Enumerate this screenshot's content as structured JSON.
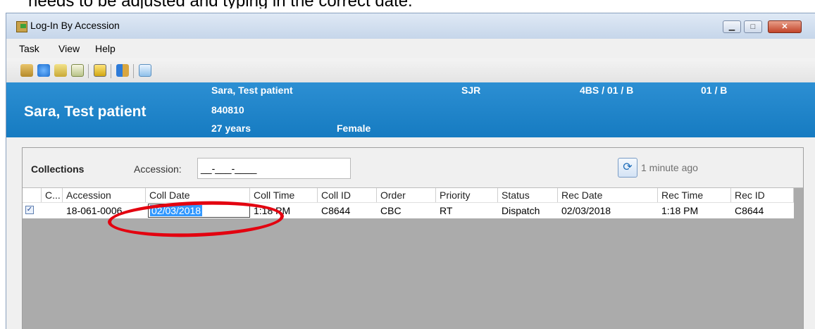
{
  "window": {
    "title": "Log-In By Accession"
  },
  "menu": {
    "items": [
      "Task",
      "View",
      "Help"
    ]
  },
  "toolbar": {
    "icons": [
      "print-icon",
      "refresh-icon",
      "label-icon",
      "report-icon",
      "comment-icon",
      "exit-icon",
      "image-icon"
    ]
  },
  "banner": {
    "big_name": "Sara, Test patient",
    "name": "Sara, Test patient",
    "mrn": "840810",
    "age": "27 years",
    "sex": "Female",
    "facility": "SJR",
    "location": "4BS / 01 / B",
    "bed": "01 / B"
  },
  "collections": {
    "title": "Collections",
    "accession_label": "Accession:",
    "accession_value": "__-___-____",
    "refresh_time": "1 minute ago",
    "columns": [
      "C...",
      "Accession",
      "Coll Date",
      "Coll Time",
      "Coll ID",
      "Order",
      "Priority",
      "Status",
      "Rec Date",
      "Rec Time",
      "Rec ID"
    ],
    "rows": [
      {
        "checked": true,
        "accession": "18-061-0006",
        "coll_date": "02/03/2018",
        "coll_time": "1:18 PM",
        "coll_id": "C8644",
        "order": "CBC",
        "priority": "RT",
        "status": "Dispatch",
        "rec_date": "02/03/2018",
        "rec_time": "1:18 PM",
        "rec_id": "C8644"
      }
    ]
  },
  "annotation": {
    "color": "#e3000f"
  }
}
